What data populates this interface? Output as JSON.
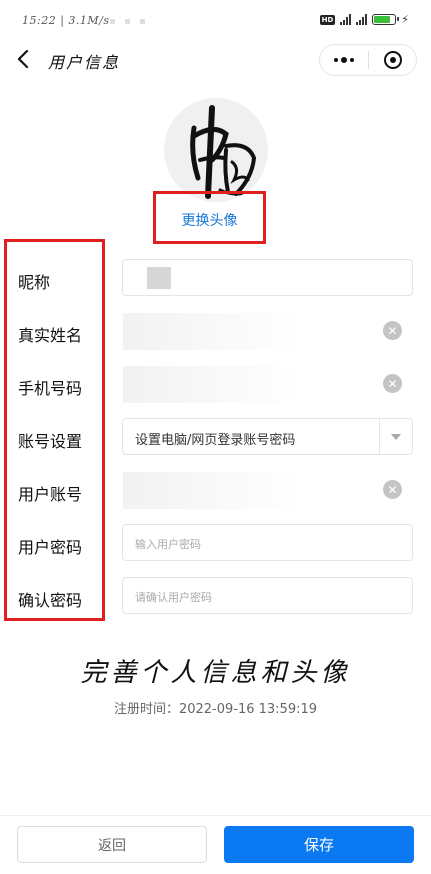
{
  "status_bar": {
    "time": "15:22 | 3.1M/s",
    "battery_icon": "battery-icon",
    "signal_icon": "signal-icon"
  },
  "nav": {
    "title": "用户信息",
    "back_icon": "chevron-left-icon",
    "more_icon": "more-dots-icon",
    "close_icon": "target-close-icon"
  },
  "avatar": {
    "change_label": "更换头像"
  },
  "form": {
    "labels": [
      "昵称",
      "真实姓名",
      "手机号码",
      "账号设置",
      "用户账号",
      "用户密码",
      "确认密码"
    ],
    "account_setting_value": "设置电脑/网页登录账号密码",
    "password_placeholder": "输入用户密码",
    "confirm_placeholder": "请确认用户密码"
  },
  "main": {
    "heading": "完善个人信息和头像",
    "register_time": "注册时间：2022-09-16 13:59:19"
  },
  "buttons": {
    "back": "返回",
    "save": "保存"
  },
  "colors": {
    "primary": "#0b79f2",
    "link": "#1677d9",
    "highlight_border": "#e02020"
  }
}
